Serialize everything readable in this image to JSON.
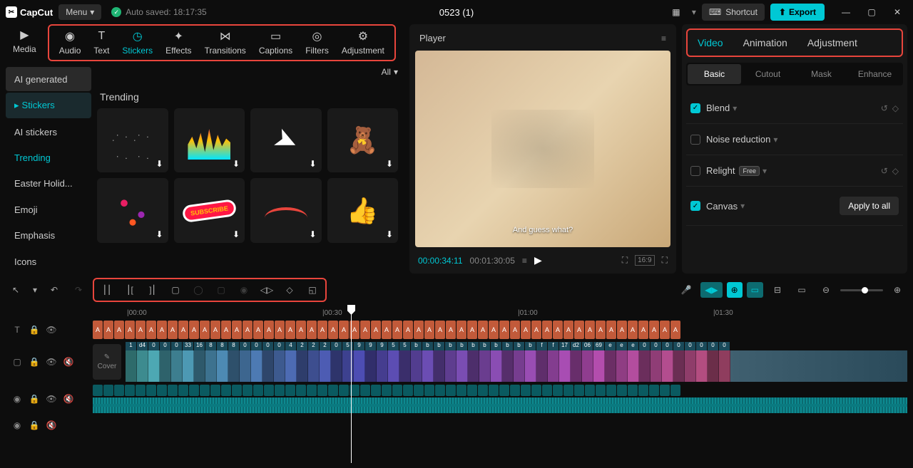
{
  "app": {
    "name": "CapCut",
    "menu": "Menu",
    "autosave": "Auto saved: 18:17:35",
    "title": "0523 (1)"
  },
  "topright": {
    "shortcut": "Shortcut",
    "export": "Export"
  },
  "tabs": {
    "media": "Media",
    "items": [
      {
        "label": "Audio"
      },
      {
        "label": "Text"
      },
      {
        "label": "Stickers"
      },
      {
        "label": "Effects"
      },
      {
        "label": "Transitions"
      },
      {
        "label": "Captions"
      },
      {
        "label": "Filters"
      },
      {
        "label": "Adjustment"
      }
    ]
  },
  "sidebar": {
    "items": [
      "AI generated",
      "Stickers",
      "AI stickers",
      "Trending",
      "Easter Holid...",
      "Emoji",
      "Emphasis",
      "Icons"
    ]
  },
  "stickerArea": {
    "all": "All",
    "trending": "Trending"
  },
  "player": {
    "title": "Player",
    "caption": "And guess what?",
    "current": "00:00:34:11",
    "total": "00:01:30:05"
  },
  "right": {
    "tabs": [
      "Video",
      "Animation",
      "Adjustment"
    ],
    "subtabs": [
      "Basic",
      "Cutout",
      "Mask",
      "Enhance"
    ],
    "props": [
      {
        "label": "Blend",
        "checked": true,
        "reset": true
      },
      {
        "label": "Noise reduction",
        "checked": false
      },
      {
        "label": "Relight",
        "checked": false,
        "badge": "Free"
      },
      {
        "label": "Canvas",
        "checked": true
      }
    ],
    "apply": "Apply to all"
  },
  "cover": "Cover",
  "ruler": [
    "00:00",
    "00:30",
    "01:00",
    "01:30"
  ]
}
